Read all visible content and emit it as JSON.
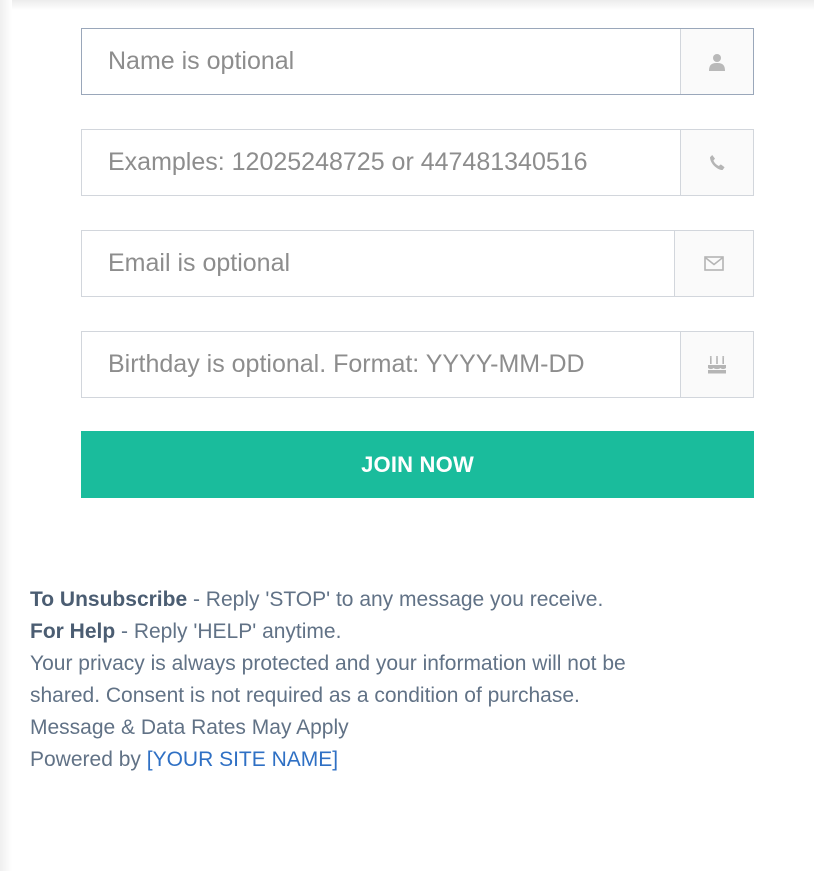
{
  "form": {
    "name": {
      "placeholder": "Name is optional",
      "icon": "user-icon"
    },
    "phone": {
      "placeholder": "Examples: 12025248725 or 447481340516",
      "icon": "phone-icon"
    },
    "email": {
      "placeholder": "Email is optional",
      "icon": "envelope-icon"
    },
    "birthday": {
      "placeholder": "Birthday is optional. Format: YYYY-MM-DD",
      "icon": "birthday-cake-icon"
    },
    "submit_label": "JOIN NOW"
  },
  "footer": {
    "unsubscribe_label": "To Unsubscribe",
    "unsubscribe_text": " - Reply 'STOP' to any message you receive.",
    "help_label": "For Help",
    "help_text": " - Reply 'HELP' anytime.",
    "privacy_line1": "Your privacy is always protected and your information will not be",
    "privacy_line2": "shared. Consent is not required as a condition of purchase.",
    "rates": "Message & Data Rates May Apply",
    "powered_prefix": "Powered by ",
    "site_name": "[YOUR SITE NAME]"
  },
  "colors": {
    "button": "#1abc9c",
    "text": "#617286",
    "link": "#2f70c4"
  }
}
